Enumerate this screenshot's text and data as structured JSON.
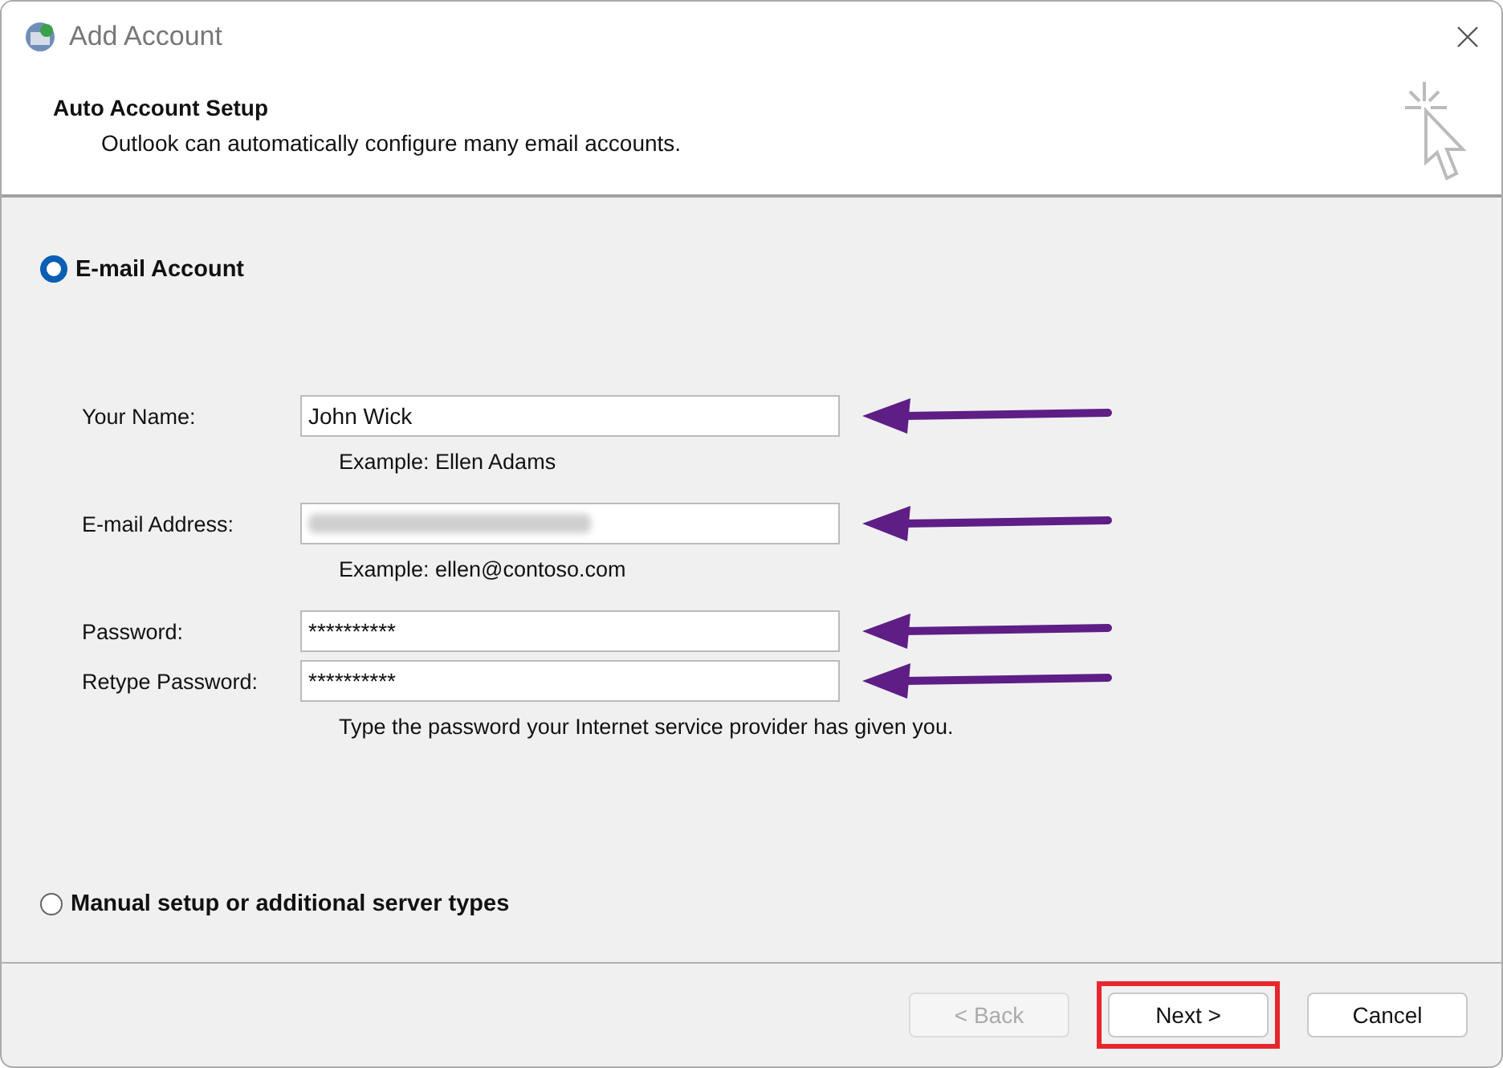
{
  "window": {
    "title": "Add Account"
  },
  "header": {
    "title": "Auto Account Setup",
    "subtitle": "Outlook can automatically configure many email accounts."
  },
  "options": [
    {
      "label": "E-mail Account",
      "selected": true
    },
    {
      "label": "Manual setup or additional server types",
      "selected": false
    }
  ],
  "fields": [
    {
      "label": "Your Name:",
      "kind": "text",
      "value": "John Wick",
      "hint": "Example: Ellen Adams",
      "highlighted": true
    },
    {
      "label": "E-mail Address:",
      "kind": "blurred",
      "hint": "Example: ellen@contoso.com",
      "highlighted": true
    },
    {
      "label": "Password:",
      "kind": "password",
      "value": "**********",
      "highlighted": true
    },
    {
      "label": "Retype Password:",
      "kind": "password",
      "value": "**********",
      "hint": "Type the password your Internet service provider has given you.",
      "highlighted": true
    }
  ],
  "buttons": [
    {
      "label": "< Back",
      "disabled": true,
      "highlighted": false
    },
    {
      "label": "Next >",
      "disabled": false,
      "highlighted": true
    },
    {
      "label": "Cancel",
      "disabled": false,
      "highlighted": false
    }
  ]
}
